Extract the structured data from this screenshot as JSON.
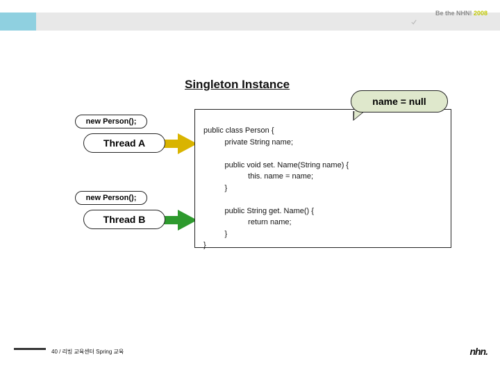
{
  "header": {
    "brand_prefix": "Be the NHN! ",
    "brand_year": "2008"
  },
  "title": "Singleton Instance",
  "callout": "name = null",
  "threadA": {
    "call": "new Person();",
    "name": "Thread A"
  },
  "threadB": {
    "call": "new Person();",
    "name": "Thread B"
  },
  "code": {
    "l1": "public class Person {",
    "l2": "          private String name;",
    "l3": "",
    "l4": "          public void set. Name(String name) {",
    "l5": "                     this. name = name;",
    "l6": "          }",
    "l7": "",
    "l8": "          public String get. Name() {",
    "l9": "                     return name;",
    "l10": "          }",
    "l11": "}"
  },
  "footer": {
    "text": "40 / 리빙 교육센터 Spring 교육",
    "logo": "nhn."
  },
  "colors": {
    "arrow_a": "#d9b400",
    "arrow_b": "#2e9a2e",
    "callout_bg": "#dfe8cc",
    "header_blue": "#8fd0e0"
  }
}
